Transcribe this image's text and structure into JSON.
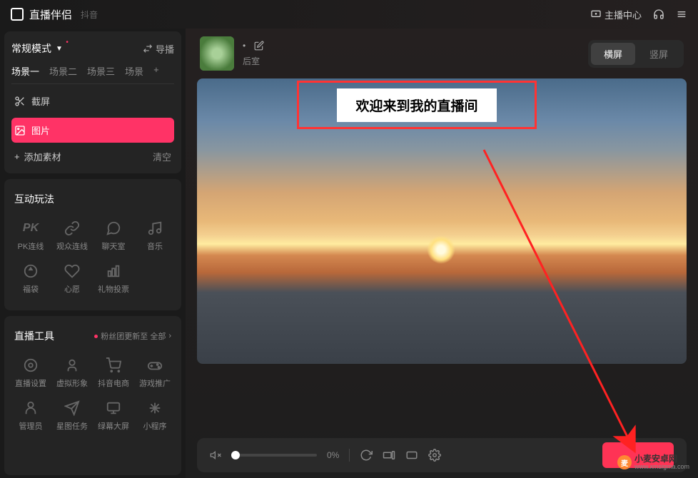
{
  "header": {
    "app_title": "直播伴侣",
    "app_sub": "抖音",
    "host_center": "主播中心"
  },
  "sidebar": {
    "mode_label": "常规模式",
    "import_label": "导播",
    "scenes": [
      "场景一",
      "场景二",
      "场景三",
      "场景"
    ],
    "screenshot_label": "截屏",
    "image_label": "图片",
    "add_material": "添加素材",
    "clear": "清空",
    "interactive_title": "互动玩法",
    "interactive_items": [
      {
        "label": "PK连线",
        "icon": "pk"
      },
      {
        "label": "观众连线",
        "icon": "link"
      },
      {
        "label": "聊天室",
        "icon": "chat"
      },
      {
        "label": "音乐",
        "icon": "music"
      },
      {
        "label": "福袋",
        "icon": "bag"
      },
      {
        "label": "心愿",
        "icon": "heart"
      },
      {
        "label": "礼物投票",
        "icon": "vote"
      }
    ],
    "tools_title": "直播工具",
    "tools_update": "粉丝团更新至 全部",
    "tools_items": [
      {
        "label": "直播设置",
        "icon": "settings"
      },
      {
        "label": "虚拟形象",
        "icon": "avatar"
      },
      {
        "label": "抖音电商",
        "icon": "shop"
      },
      {
        "label": "游戏推广",
        "icon": "game"
      },
      {
        "label": "管理员",
        "icon": "admin"
      },
      {
        "label": "星图任务",
        "icon": "star"
      },
      {
        "label": "绿幕大屏",
        "icon": "screen"
      },
      {
        "label": "小程序",
        "icon": "app"
      }
    ]
  },
  "content": {
    "backroom": "后室",
    "orientation": {
      "landscape": "横屏",
      "portrait": "竖屏"
    },
    "welcome_text": "欢迎来到我的直播间",
    "volume_percent": "0%"
  },
  "watermark": {
    "main": "小麦安卓网",
    "sub": "www.xmsigma.com"
  }
}
